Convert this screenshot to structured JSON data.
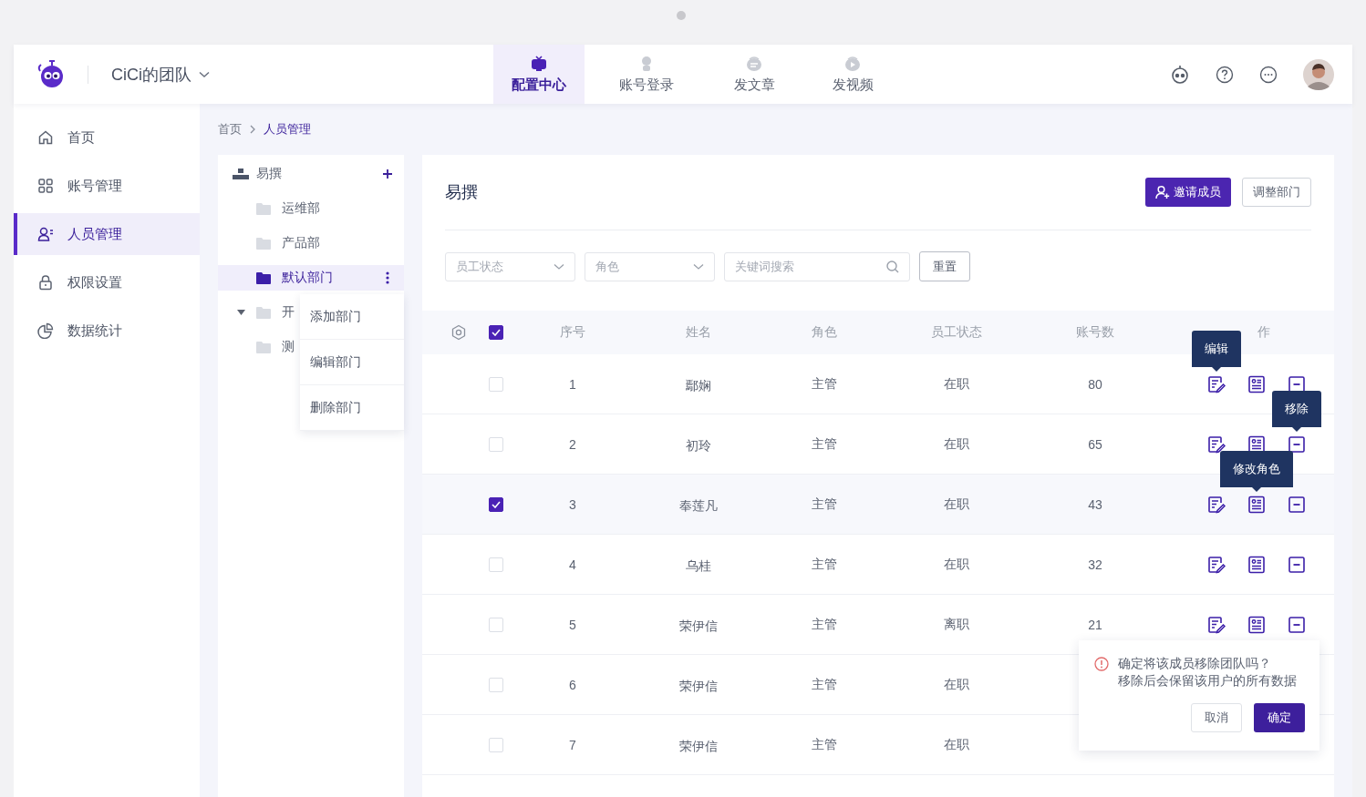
{
  "header": {
    "team_name": "CiCi的团队",
    "tabs": [
      {
        "label": "配置中心",
        "selected": true
      },
      {
        "label": "账号登录",
        "selected": false
      },
      {
        "label": "发文章",
        "selected": false
      },
      {
        "label": "发视频",
        "selected": false
      }
    ]
  },
  "sidebar": {
    "items": [
      {
        "label": "首页",
        "selected": false
      },
      {
        "label": "账号管理",
        "selected": false
      },
      {
        "label": "人员管理",
        "selected": true
      },
      {
        "label": "权限设置",
        "selected": false
      },
      {
        "label": "数据统计",
        "selected": false
      }
    ]
  },
  "breadcrumb": [
    "首页",
    "人员管理"
  ],
  "department_tree": {
    "root": "易撰",
    "children": [
      {
        "label": "运维部",
        "selected": false,
        "expanded": false
      },
      {
        "label": "产品部",
        "selected": false,
        "expanded": false
      },
      {
        "label": "默认部门",
        "selected": true,
        "expanded": false
      },
      {
        "label": "开",
        "selected": false,
        "expanded": true
      },
      {
        "label": "测",
        "selected": false,
        "expanded": false
      }
    ],
    "menu": [
      "添加部门",
      "编辑部门",
      "删除部门"
    ]
  },
  "panel": {
    "title": "易撰",
    "buttons": [
      {
        "label": "邀请成员",
        "kind": "primary"
      },
      {
        "label": "调整部门",
        "kind": "default"
      }
    ]
  },
  "filters": [
    {
      "kind": "select",
      "placeholder": "员工状态"
    },
    {
      "kind": "select",
      "placeholder": "角色"
    },
    {
      "kind": "search",
      "placeholder": "关键词搜索"
    }
  ],
  "reset_button": "重置",
  "table": {
    "all_checked": true,
    "columns": [
      "序号",
      "姓名",
      "角色",
      "员工状态",
      "账号数",
      "作"
    ],
    "rows": [
      {
        "checked": false,
        "cells": [
          "1",
          "鄢娴",
          "主管",
          "在职",
          "80"
        ],
        "actions": [
          {
            "kind": "edit",
            "tooltip": "编辑"
          },
          {
            "kind": "role"
          },
          {
            "kind": "remove"
          }
        ]
      },
      {
        "checked": false,
        "cells": [
          "2",
          "初玲",
          "主管",
          "在职",
          "65"
        ],
        "actions": [
          {
            "kind": "edit"
          },
          {
            "kind": "role"
          },
          {
            "kind": "remove",
            "tooltip": "移除"
          }
        ]
      },
      {
        "checked": true,
        "cells": [
          "3",
          "奉莲凡",
          "主管",
          "在职",
          "43"
        ],
        "actions": [
          {
            "kind": "edit"
          },
          {
            "kind": "role",
            "tooltip": "修改角色"
          },
          {
            "kind": "remove"
          }
        ]
      },
      {
        "checked": false,
        "cells": [
          "4",
          "乌桂",
          "主管",
          "在职",
          "32"
        ],
        "actions": [
          {
            "kind": "edit"
          },
          {
            "kind": "role"
          },
          {
            "kind": "remove"
          }
        ]
      },
      {
        "checked": false,
        "cells": [
          "5",
          "荣伊信",
          "主管",
          "离职",
          "21"
        ],
        "actions": [
          {
            "kind": "edit"
          },
          {
            "kind": "role"
          },
          {
            "kind": "remove"
          }
        ]
      },
      {
        "checked": false,
        "cells": [
          "6",
          "荣伊信",
          "主管",
          "在职"
        ]
      },
      {
        "checked": false,
        "cells": [
          "7",
          "荣伊信",
          "主管",
          "在职"
        ]
      }
    ]
  },
  "popconfirm": {
    "title": "确定将该成员移除团队吗？",
    "message": "移除后会保留该用户的所有数据",
    "buttons": [
      {
        "label": "取消",
        "kind": "default"
      },
      {
        "label": "确定",
        "kind": "primary"
      }
    ]
  }
}
